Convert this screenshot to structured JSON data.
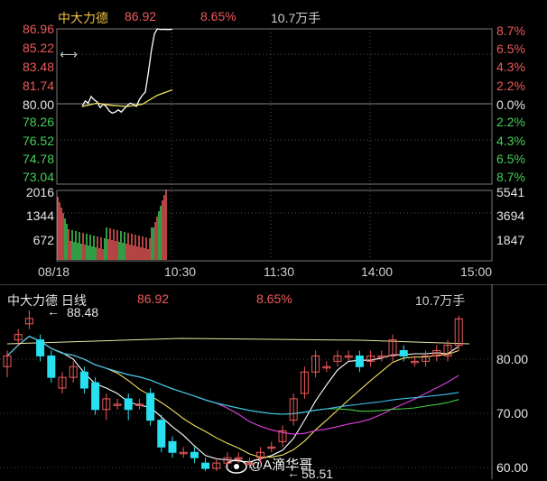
{
  "colors": {
    "up": "#f05a5a",
    "down": "#43d15a",
    "neutral": "#e6e6e6",
    "gold": "#f0c040",
    "cyan_candle": "#27e0f0",
    "grid": "#555555"
  },
  "intraday": {
    "header": {
      "name": "中大力德",
      "price": "86.92",
      "pct": "8.65%",
      "volume": "10.7万手"
    },
    "price_ticks_left": [
      "86.96",
      "85.22",
      "83.48",
      "81.74",
      "80.00",
      "78.26",
      "76.52",
      "74.78",
      "73.04"
    ],
    "pct_ticks_right": [
      "8.7%",
      "6.5%",
      "4.3%",
      "2.2%",
      "0.0%",
      "2.2%",
      "4.3%",
      "6.5%",
      "8.7%"
    ],
    "volume_ticks_left": [
      "2016",
      "1344",
      "672"
    ],
    "volume_ticks_right": [
      "5541",
      "3694",
      "1847"
    ],
    "time_labels": [
      "08/18",
      "10:30",
      "11:30",
      "14:00",
      "15:00"
    ],
    "expand_icon": "double-arrow-icon"
  },
  "daily": {
    "header": {
      "name": "中大力德 日线",
      "price": "86.92",
      "pct": "8.65%",
      "volume": "10.7万手"
    },
    "price_ticks": [
      "80.00",
      "70.00",
      "60.00"
    ],
    "high_label": "88.48",
    "low_label": "58.51",
    "watermark": "@A滴华哥"
  },
  "chart_data": [
    {
      "type": "line",
      "title": "中大力德",
      "series": [
        {
          "name": "price",
          "x": [
            0,
            1,
            2,
            3,
            4,
            5,
            6,
            7,
            8,
            9,
            10,
            11,
            12,
            13,
            14,
            15,
            16,
            17,
            18,
            19,
            20,
            21,
            22,
            23,
            24,
            25,
            26,
            27,
            28,
            29,
            30
          ],
          "values": [
            80.0,
            80.5,
            80.3,
            80.9,
            80.6,
            80.4,
            79.9,
            80.2,
            80.0,
            79.6,
            79.4,
            79.5,
            79.7,
            79.5,
            79.8,
            80.1,
            80.3,
            80.2,
            80.0,
            80.6,
            81.0,
            81.3,
            83.0,
            85.0,
            86.5,
            86.96,
            86.9,
            86.92,
            86.9,
            86.9,
            86.92
          ]
        },
        {
          "name": "avg",
          "x": [
            0,
            5,
            10,
            15,
            20,
            25,
            30
          ],
          "values": [
            80.0,
            80.3,
            80.1,
            80.0,
            80.2,
            81.0,
            81.5
          ]
        }
      ],
      "ylim": [
        73.04,
        86.96
      ]
    },
    {
      "type": "candlestick",
      "title": "中大力德 日线",
      "series": [
        {
          "name": "candles",
          "x": [
            1,
            2,
            3,
            4,
            5,
            6,
            7,
            8,
            9,
            10,
            11,
            12,
            13,
            14,
            15,
            16,
            17,
            18,
            19,
            20,
            21,
            22,
            23,
            24,
            25,
            26,
            27,
            28,
            29,
            30,
            31,
            32,
            33,
            34,
            35,
            36,
            37,
            38,
            39,
            40,
            41,
            42
          ],
          "values": [
            [
              78,
              80,
              76,
              81
            ],
            [
              83,
              84,
              82,
              85
            ],
            [
              86,
              87,
              85,
              88.48
            ],
            [
              83,
              80,
              79,
              84
            ],
            [
              80,
              76,
              75,
              81
            ],
            [
              74,
              76,
              73,
              77
            ],
            [
              76,
              78,
              75,
              79
            ],
            [
              77,
              74,
              73,
              78
            ],
            [
              75,
              70,
              69,
              76
            ],
            [
              70,
              72,
              68,
              73
            ],
            [
              71,
              71,
              70,
              72
            ],
            [
              72,
              70,
              68,
              73
            ],
            [
              71,
              71,
              70,
              72
            ],
            [
              73,
              68,
              67,
              74
            ],
            [
              68,
              63,
              62,
              69
            ],
            [
              64,
              62,
              61,
              65
            ],
            [
              62,
              62,
              61,
              63
            ],
            [
              62,
              61,
              60,
              63
            ],
            [
              60,
              59,
              58.51,
              61
            ],
            [
              59,
              60,
              58.51,
              61
            ],
            [
              60,
              61,
              59,
              62
            ],
            [
              61,
              61,
              60,
              62
            ],
            [
              60,
              60,
              59,
              61
            ],
            [
              61,
              62,
              60,
              63
            ],
            [
              63,
              63,
              62,
              64
            ],
            [
              64,
              66,
              63,
              67
            ],
            [
              68,
              72,
              67,
              73
            ],
            [
              73,
              77,
              72,
              78
            ],
            [
              77,
              80,
              76,
              81
            ],
            [
              78,
              78,
              77,
              79
            ],
            [
              79,
              80,
              78,
              81
            ],
            [
              80,
              80,
              79,
              81
            ],
            [
              80,
              78,
              77,
              81
            ],
            [
              79,
              80,
              78,
              81
            ],
            [
              80,
              80,
              79,
              81
            ],
            [
              80,
              83,
              79,
              84
            ],
            [
              81,
              80,
              79,
              82
            ],
            [
              79,
              79,
              78,
              80
            ],
            [
              79,
              80,
              78,
              81
            ],
            [
              80,
              81,
              79,
              82
            ],
            [
              80,
              82,
              79,
              83
            ],
            [
              82,
              86.92,
              81,
              87.5
            ]
          ]
        }
      ],
      "ylim": [
        58,
        89
      ]
    }
  ]
}
